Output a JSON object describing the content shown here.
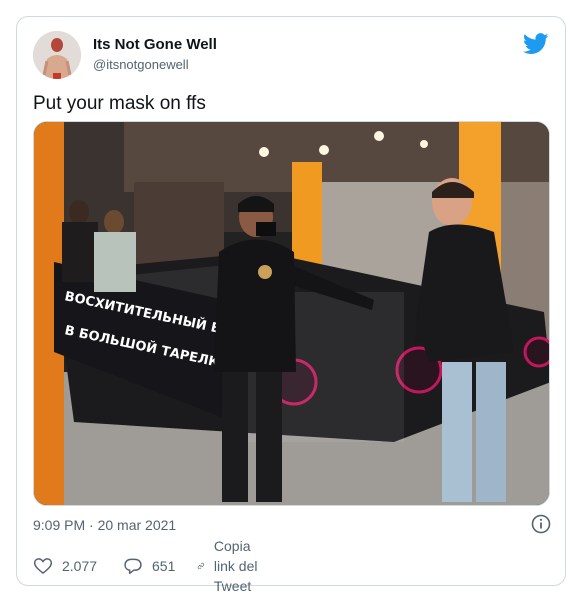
{
  "tweet": {
    "author": {
      "display_name": "Its Not Gone Well",
      "handle": "@itsnotgonewell",
      "avatar_icon": "avatar-photo"
    },
    "brand_icon": "twitter-bird-icon",
    "brand_color": "#1d9bf0",
    "text": "Put your mask on ffs",
    "media": {
      "kind": "video-still",
      "banner_lines": [
        "ВОСХИТИТЕЛЬНЫЙ ВКУС",
        "В БОЛЬШОЙ ТАРЕЛКЕ"
      ]
    },
    "timestamp": "9:09 PM · 20 mar 2021",
    "info_icon": "info-icon",
    "actions": {
      "likes": "2.077",
      "replies": "651",
      "copy_link_label": "Copia link del Tweet"
    }
  }
}
